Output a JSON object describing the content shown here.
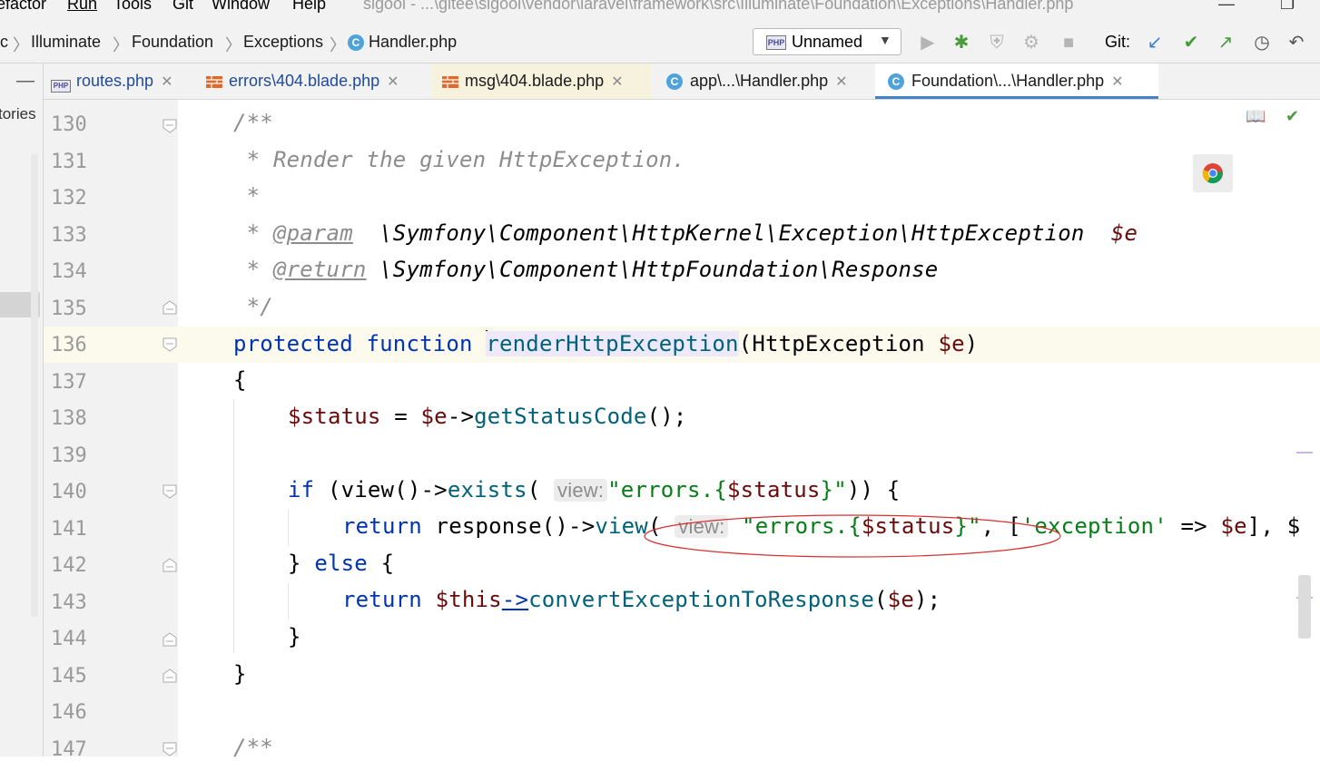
{
  "menu": {
    "items": [
      "efactor",
      "Run",
      "Tools",
      "Git",
      "Window",
      "Help"
    ],
    "title": "sigool - ...\\gitee\\sigool\\vendor\\laravel\\framework\\src\\Illuminate\\Foundation\\Exceptions\\Handler.php"
  },
  "breadcrumb": {
    "items": [
      "c",
      "Illuminate",
      "Foundation",
      "Exceptions",
      "Handler.php"
    ]
  },
  "run_config": {
    "label": "Unnamed"
  },
  "git": {
    "label": "Git:"
  },
  "tabs": [
    {
      "label": "routes.php"
    },
    {
      "label": "errors\\404.blade.php"
    },
    {
      "label": "msg\\404.blade.php"
    },
    {
      "label": "app\\...\\Handler.php"
    },
    {
      "label": "Foundation\\...\\Handler.php"
    }
  ],
  "side_label": "tories",
  "line_numbers": [
    "130",
    "131",
    "132",
    "133",
    "134",
    "135",
    "136",
    "137",
    "138",
    "139",
    "140",
    "141",
    "142",
    "143",
    "144",
    "145",
    "146",
    "147"
  ],
  "code": {
    "l130": "/**",
    "l131": " * Render the given HttpException.",
    "l132": " *",
    "l133_pre": " * ",
    "l133_tag": "@param",
    "l133_type": "  \\Symfony\\Component\\HttpKernel\\Exception\\HttpException  ",
    "l133_var": "$e",
    "l134_pre": " * ",
    "l134_tag": "@return",
    "l134_type": " \\Symfony\\Component\\HttpFoundation\\Response",
    "l135": " */",
    "l136_kw": "protected function ",
    "l136_fn": "renderHttpException",
    "l136_rest1": "(HttpException ",
    "l136_var": "$e",
    "l136_rest2": ")",
    "l137": "{",
    "l138_var1": "$status",
    "l138_mid": " = ",
    "l138_var2": "$e",
    "l138_arrow": "->",
    "l138_fn": "getStatusCode",
    "l138_end": "();",
    "l140_kw": "if",
    "l140_a": " (view()->",
    "l140_fn": "exists",
    "l140_b": "( ",
    "l140_hint": "view:",
    "l140_str1": "\"errors.{",
    "l140_var": "$status",
    "l140_str2": "}\"",
    "l140_end": ")) {",
    "l141_kw": "return",
    "l141_a": " response()->",
    "l141_fn": "view",
    "l141_b": "( ",
    "l141_hint": "view:",
    "l141_str1": " \"errors.{",
    "l141_var": "$status",
    "l141_str2": "}\"",
    "l141_c": ", [",
    "l141_str3": "'exception'",
    "l141_d": " => ",
    "l141_var2": "$e",
    "l141_e": "], $",
    "l142_a": "} ",
    "l142_kw": "else",
    "l142_b": " {",
    "l143_kw": "return",
    "l143_sp": " ",
    "l143_var": "$this",
    "l143_arrow": "->",
    "l143_fn": "convertExceptionToResponse",
    "l143_a": "(",
    "l143_var2": "$e",
    "l143_b": ");",
    "l144": "}",
    "l145": "}",
    "l147": "/**"
  }
}
